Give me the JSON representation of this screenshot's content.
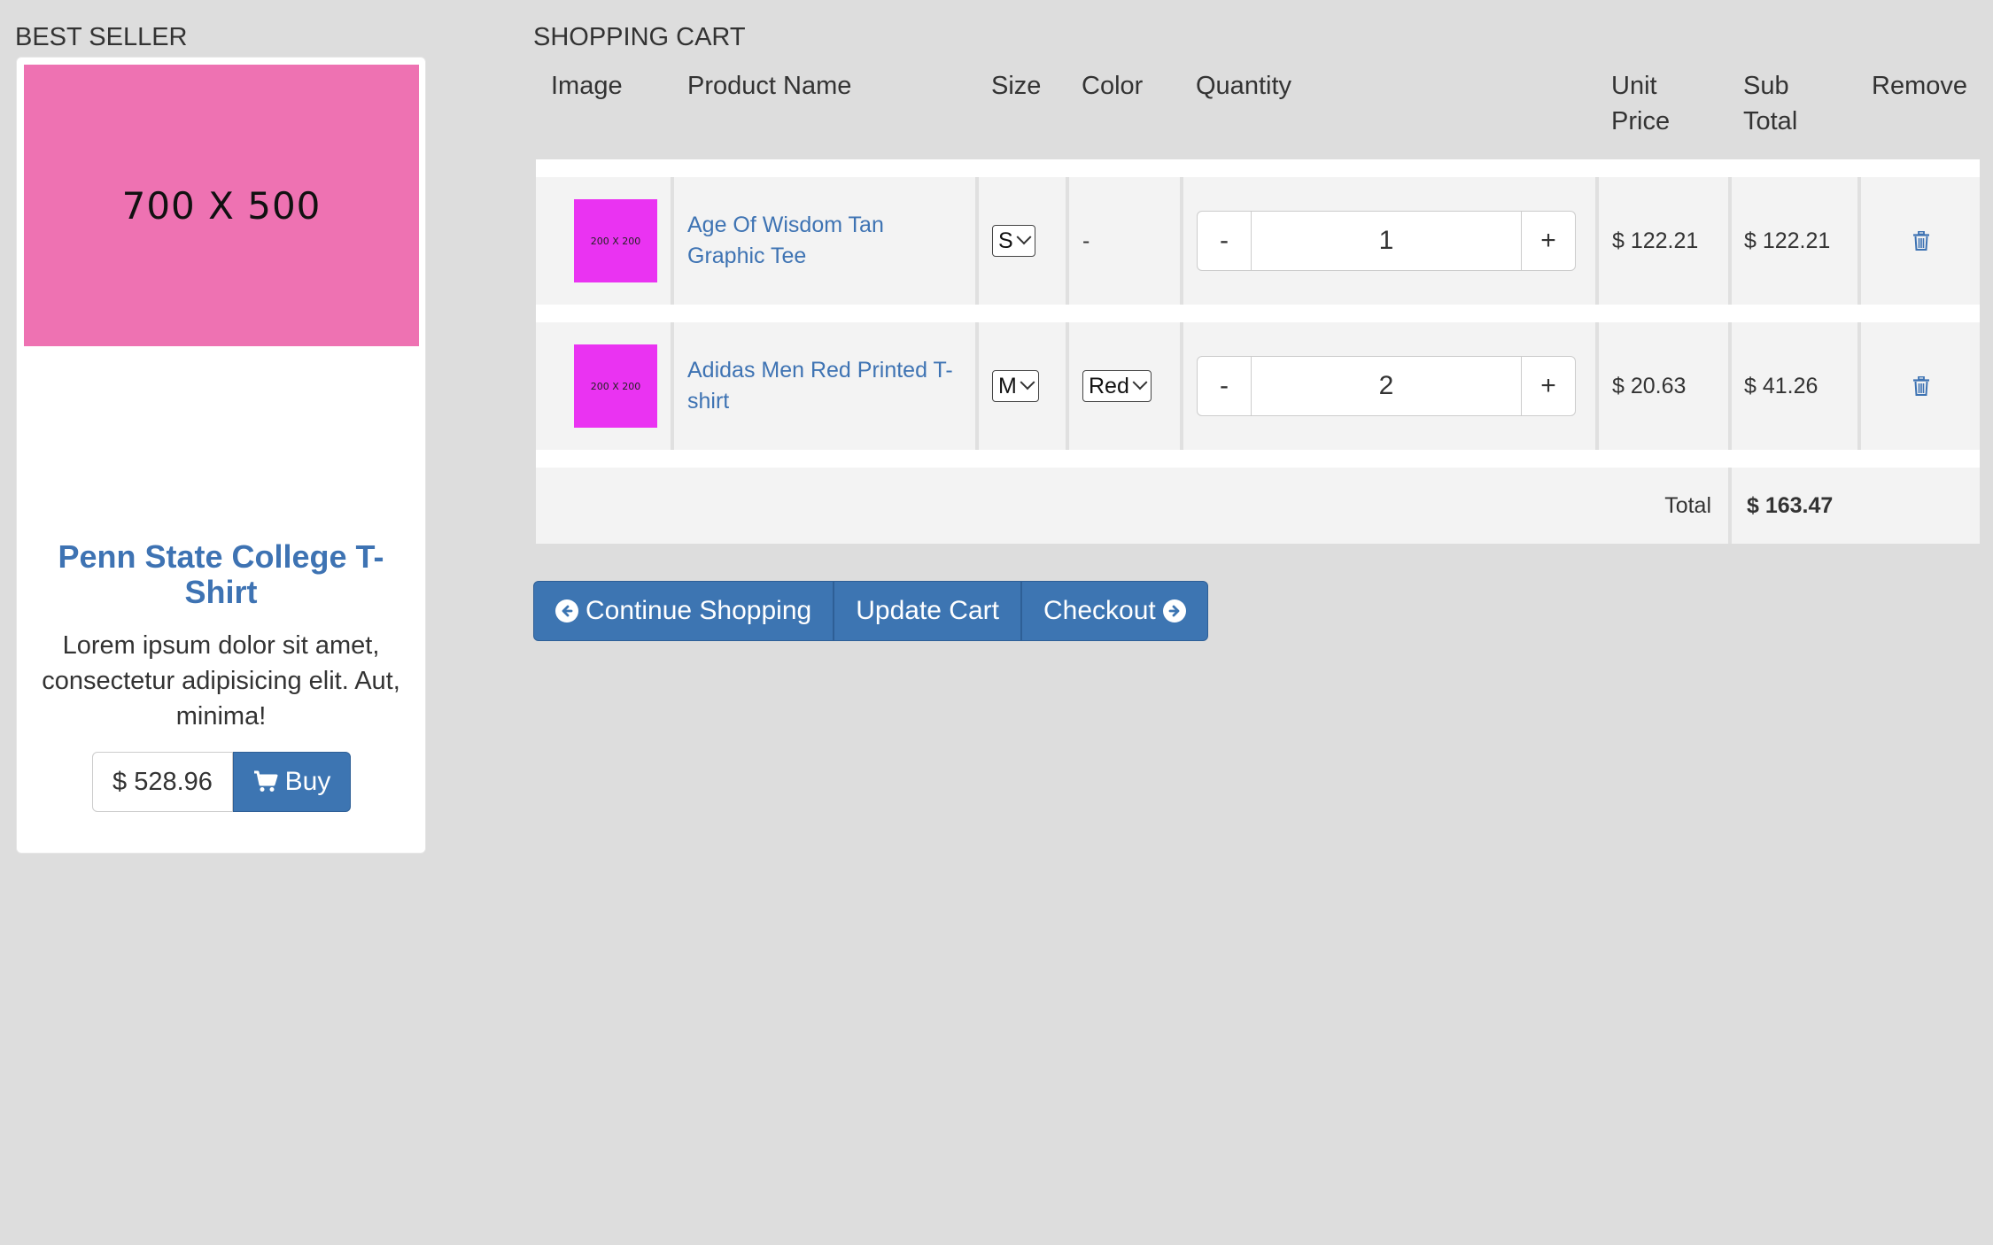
{
  "best_seller": {
    "section_title": "BEST SELLER",
    "image_placeholder": "700 X 500",
    "product_name": "Penn State College T-Shirt",
    "description": "Lorem ipsum dolor sit amet, consectetur adipisicing elit. Aut, minima!",
    "price": "$ 528.96",
    "buy_label": "Buy"
  },
  "cart": {
    "section_title": "SHOPPING CART",
    "headers": {
      "image": "Image",
      "product_name": "Product Name",
      "size": "Size",
      "color": "Color",
      "quantity": "Quantity",
      "unit_price_line1": "Unit",
      "unit_price_line2": "Price",
      "sub_total_line1": "Sub",
      "sub_total_line2": "Total",
      "remove": "Remove"
    },
    "items": [
      {
        "thumb": "200 X 200",
        "name": "Age Of Wisdom Tan Graphic Tee",
        "size": "S",
        "color": "-",
        "quantity": "1",
        "unit_price": "$ 122.21",
        "sub_total": "$ 122.21"
      },
      {
        "thumb": "200 X 200",
        "name": "Adidas Men Red Printed T-shirt",
        "size": "M",
        "color": "Red",
        "quantity": "2",
        "unit_price": "$ 20.63",
        "sub_total": "$ 41.26"
      }
    ],
    "minus_label": "-",
    "plus_label": "+",
    "total_label": "Total",
    "total_value": "$ 163.47",
    "buttons": {
      "continue": "Continue Shopping",
      "update": "Update Cart",
      "checkout": "Checkout"
    }
  },
  "colors": {
    "accent": "#3d75b2",
    "link": "#3e73b3",
    "background": "#dddddd",
    "placeholder_large": "#ee72b2",
    "placeholder_thumb": "#ea33f2"
  }
}
